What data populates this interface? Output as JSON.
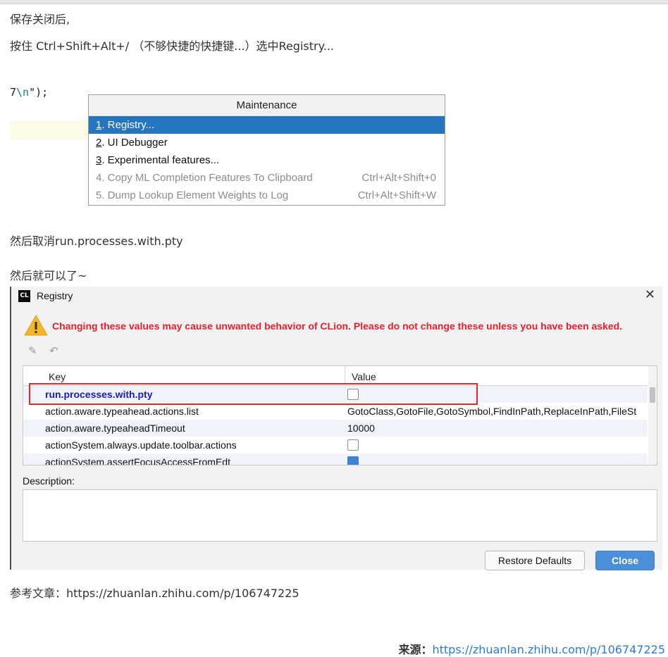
{
  "article": {
    "line1": "保存关闭后,",
    "line2": "按住 Ctrl+Shift+Alt+/ （不够快捷的快捷键...）选中Registry...",
    "line3": "然后取消run.processes.with.pty",
    "line4": "然后就可以了~",
    "reference": "参考文章：https://zhuanlan.zhihu.com/p/106747225",
    "source_label": "来源：",
    "source_url": "https://zhuanlan.zhihu.com/p/106747225"
  },
  "code_fragment": {
    "prefix": "7",
    "escape": "\\n",
    "suffix": "\");"
  },
  "maintenance_popup": {
    "title": "Maintenance",
    "items": [
      {
        "mnemonic": "1",
        "label": ". Registry...",
        "shortcut": "",
        "selected": true,
        "enabled": true
      },
      {
        "mnemonic": "2",
        "label": ". UI Debugger",
        "shortcut": "",
        "selected": false,
        "enabled": true
      },
      {
        "mnemonic": "3",
        "label": ". Experimental features...",
        "shortcut": "",
        "selected": false,
        "enabled": true
      },
      {
        "mnemonic": "4",
        "label": ". Copy ML Completion Features To Clipboard",
        "shortcut": "Ctrl+Alt+Shift+0",
        "selected": false,
        "enabled": false
      },
      {
        "mnemonic": "5",
        "label": ". Dump Lookup Element Weights to Log",
        "shortcut": "Ctrl+Alt+Shift+W",
        "selected": false,
        "enabled": false
      }
    ]
  },
  "registry_dialog": {
    "logo_text": "CL",
    "title": "Registry",
    "close_glyph": "✕",
    "warning": "Changing these values may cause unwanted behavior of CLion. Please do not change these unless you have been asked.",
    "toolbar": {
      "edit_glyph": "✎",
      "revert_glyph": "↶"
    },
    "table": {
      "col_key": "Key",
      "col_value": "Value",
      "rows": [
        {
          "key": "run.processes.with.pty",
          "type": "checkbox",
          "checked": false,
          "highlighted": true
        },
        {
          "key": "action.aware.typeahead.actions.list",
          "type": "text",
          "value": "GotoClass,GotoFile,GotoSymbol,FindInPath,ReplaceInPath,FileSt"
        },
        {
          "key": "action.aware.typeaheadTimeout",
          "type": "text",
          "value": "10000"
        },
        {
          "key": "actionSystem.always.update.toolbar.actions",
          "type": "checkbox",
          "checked": false
        },
        {
          "key": "actionSystem.assertFocusAccessFromEdt",
          "type": "checkbox",
          "checked": true
        }
      ]
    },
    "description_label": "Description:",
    "restore_button": "Restore Defaults",
    "close_button": "Close"
  },
  "colors": {
    "selection": "#2675bf",
    "warning_red": "#e8202e",
    "link_blue": "#2c7ad6",
    "highlight_box": "#e32a2a"
  }
}
